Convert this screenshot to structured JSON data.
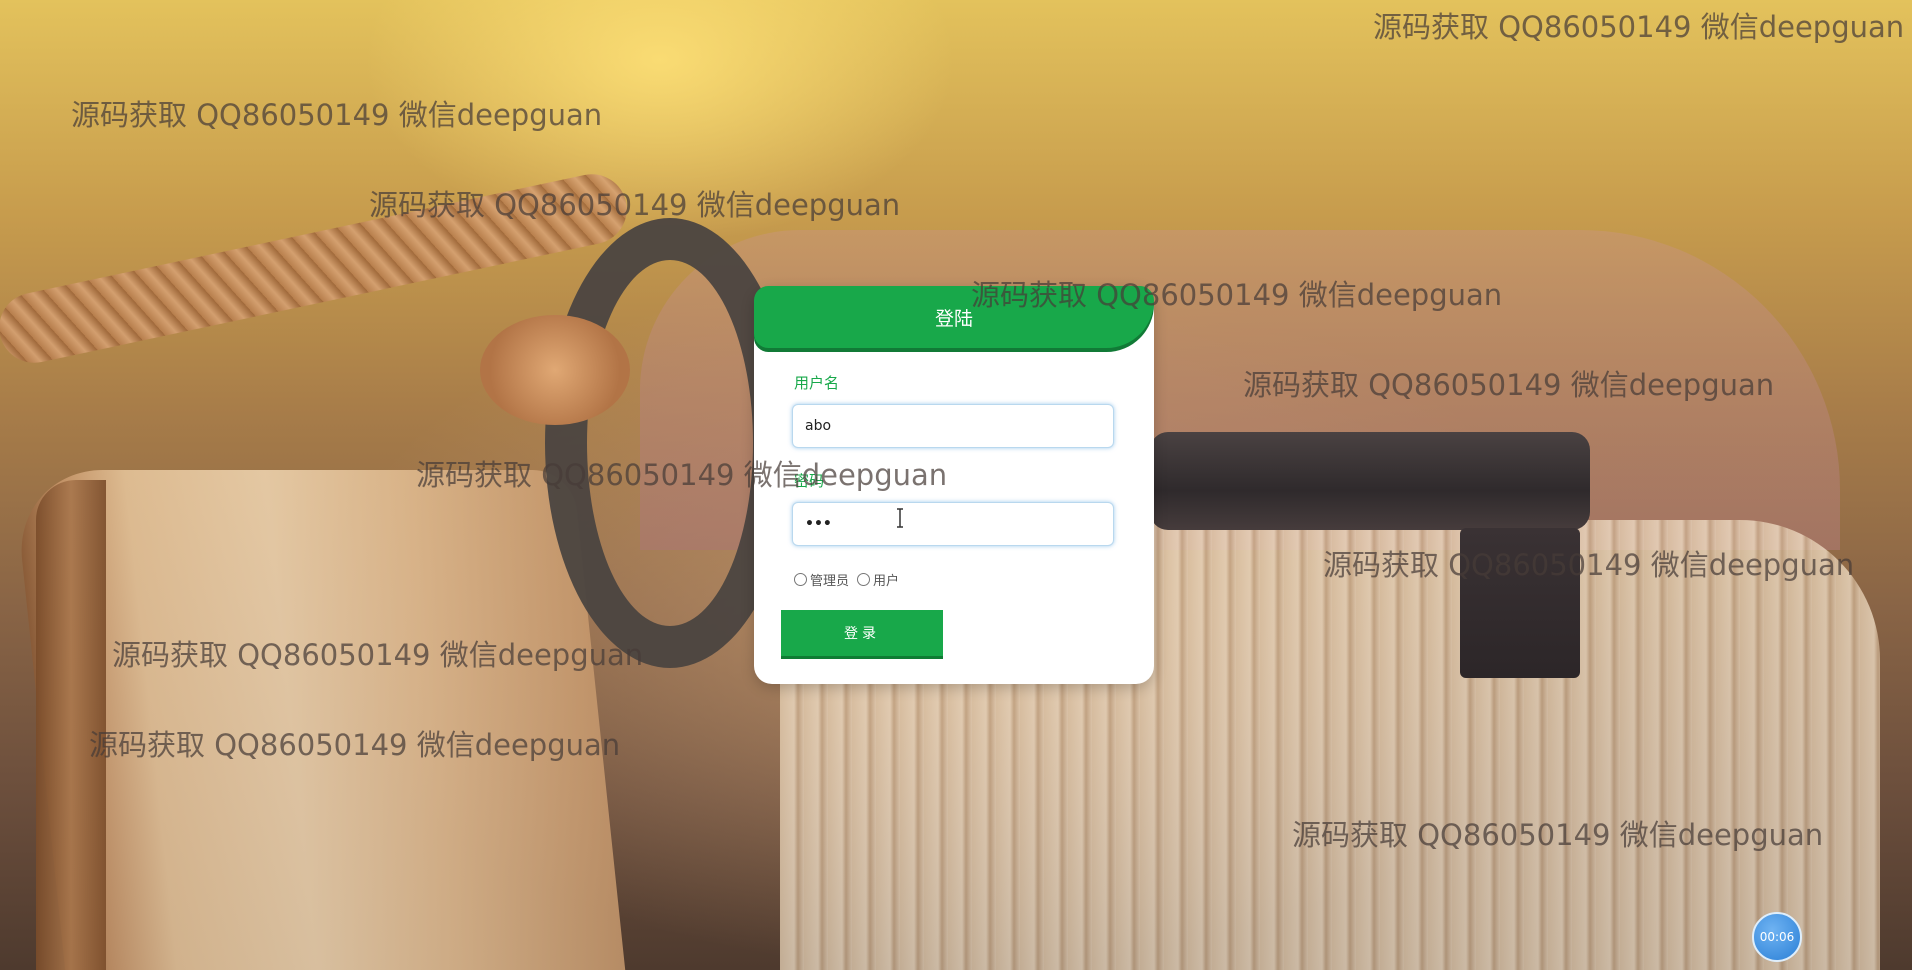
{
  "watermark_text": "源码获取 QQ86050149 微信deepguan",
  "login": {
    "title": "登陆",
    "username_label": "用户名",
    "username_value": "abo",
    "password_label": "密码",
    "password_value": "•••",
    "roles": [
      "管理员",
      "用户"
    ],
    "submit_label": "登录"
  },
  "timer": {
    "value": "00:06"
  },
  "colors": {
    "accent": "#18a84a",
    "timer": "#2a7fd6"
  }
}
